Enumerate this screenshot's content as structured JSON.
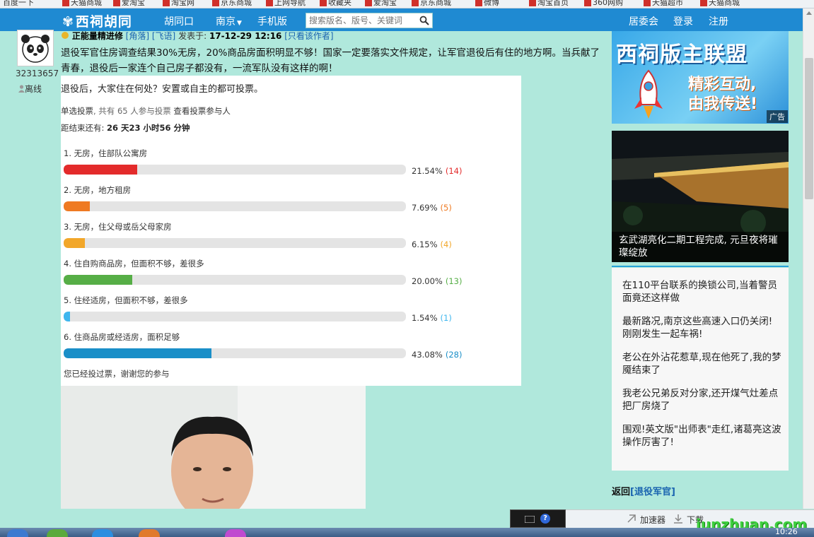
{
  "bookmarks": [
    "百度一下",
    "天猫商城",
    "爱淘宝",
    "淘宝网",
    "京东商城",
    "上网导航",
    "收藏夹",
    "爱淘宝",
    "京东商城",
    "微博",
    "淘宝首页",
    "360网购",
    "天猫超市",
    "天猫商城"
  ],
  "nav": {
    "logo": "西祠胡同",
    "links": [
      "胡同口",
      "南京",
      "手机版"
    ],
    "search_placeholder": "搜索版名、版号、关键词",
    "right_links": [
      "居委会",
      "登录",
      "注册"
    ]
  },
  "user": {
    "uid": "32313657",
    "status": "离线"
  },
  "post": {
    "author": "正能量精进修",
    "tag1": "[角落]",
    "tag2": "[飞语]",
    "posted_label": "发表于:",
    "posted_time": "17-12-29 12:16",
    "only_author": "[只看该作者]",
    "body": "退役军官住房调查结果30%无房，20%商品房面积明显不够！国家一定要落实文件规定，让军官退役后有住的地方啊。当兵献了青春，退役后一家连个自己房子都没有，一流军队没有这样的啊！"
  },
  "poll": {
    "question": "退役后，大家住在何处？安置或自主的都可投票。",
    "type_label": "单选投票",
    "participants_text": ", 共有 65 人参与投票",
    "view_voters": "查看投票参与人",
    "ends_label": "距结束还有:",
    "ends_value": "26 天23 小时56 分钟",
    "options": [
      {
        "label": "1. 无房，住部队公寓房",
        "percent": 21.54,
        "percent_text": "21.54%",
        "count_text": "(14)",
        "color": "#e32b2b"
      },
      {
        "label": "2. 无房，地方租房",
        "percent": 7.69,
        "percent_text": "7.69%",
        "count_text": "(5)",
        "color": "#ef7a22"
      },
      {
        "label": "3. 无房，住父母或岳父母家房",
        "percent": 6.15,
        "percent_text": "6.15%",
        "count_text": "(4)",
        "color": "#f2a72a"
      },
      {
        "label": "4. 住自购商品房，但面积不够，差很多",
        "percent": 20.0,
        "percent_text": "20.00%",
        "count_text": "(13)",
        "color": "#56ae46"
      },
      {
        "label": "5. 住经适房，但面积不够，差很多",
        "percent": 1.54,
        "percent_text": "1.54%",
        "count_text": "(1)",
        "color": "#3eb6ee"
      },
      {
        "label": "6. 住商品房或经适房，面积足够",
        "percent": 43.08,
        "percent_text": "43.08%",
        "count_text": "(28)",
        "color": "#1a8fc8"
      }
    ],
    "voted_text": "您已经投过票，谢谢您的参与"
  },
  "sidebar": {
    "ad": {
      "title": "西祠版主联盟",
      "sub1": "精彩互动,",
      "sub2": "由我传送!",
      "tag": "广告"
    },
    "news_caption": "玄武湖亮化二期工程完成, 元旦夜将璀璨绽放",
    "news_items": [
      "在110平台联系的换锁公司,当着警员面竟还这样做",
      "最新路况,南京这些高速入口仍关闭!刚刚发生一起车祸!",
      "老公在外沾花惹草,现在他死了,我的梦魇结束了",
      "我老公兄弟反对分家,还开煤气灶差点把厂房烧了",
      "围观!英文版\"出师表\"走红,诸葛亮这波操作厉害了!"
    ],
    "back_label": "返回",
    "back_link": "[退役军官]"
  },
  "statusbar": {
    "accelerator": "加速器",
    "download": "下载",
    "clock": "10:26"
  },
  "watermark": "junzhuan.com"
}
